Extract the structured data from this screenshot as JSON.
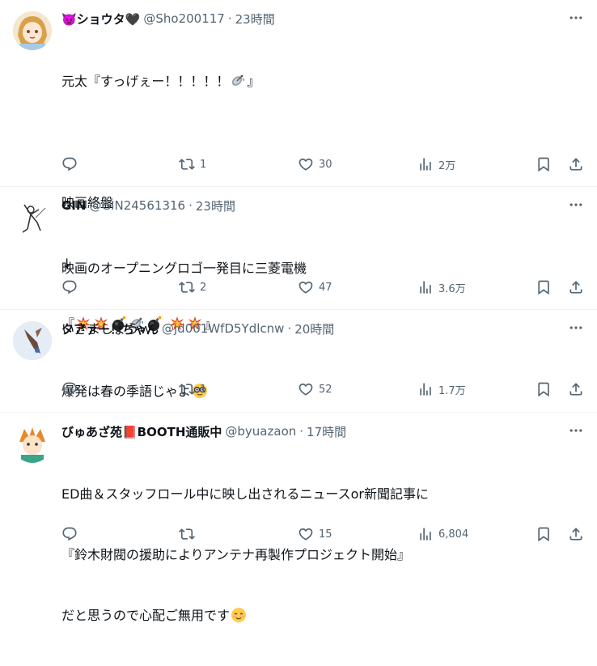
{
  "tweets": [
    {
      "name": "👿ショウタ🖤",
      "handle": "@Sho200117",
      "time": "23時間",
      "text_line1": "元太『すっげぇー！！！！！",
      "text_line1_end": "』",
      "text_line2": "映画終盤",
      "text_line3": "↓",
      "text_line4": "『",
      "text_line4_end": "』",
      "reply_count": "",
      "retweet_count": "1",
      "like_count": "30",
      "view_count": "2万"
    },
    {
      "name": "GIN",
      "handle": "@GIN24561316",
      "time": "23時間",
      "text_line1": "映画のオープニングロゴ一発目に三菱電機",
      "text_line2": "いきましょうｗ",
      "reply_count": "",
      "retweet_count": "2",
      "like_count": "47",
      "view_count": "3.6万"
    },
    {
      "name": "タアァー！ちゃん",
      "handle": "@jd001WfD5Ydlcnw",
      "time": "20時間",
      "text_line1": "爆発は春の季語じゃよ",
      "reply_count": "",
      "retweet_count": "1",
      "like_count": "52",
      "view_count": "1.7万"
    },
    {
      "name": "びゅあざ苑📕BOOTH通販中",
      "handle": "@byuazaon",
      "time": "17時間",
      "text_line1": "ED曲＆スタッフロール中に映し出されるニュースor新聞記事に",
      "text_line2": "『鈴木財閥の援助によりアンテナ再製作プロジェクト開始』",
      "text_line3": "だと思うので心配ご無用です",
      "reply_count": "",
      "retweet_count": "",
      "like_count": "15",
      "view_count": "6,804"
    }
  ],
  "icons": {
    "reply": "reply-icon",
    "retweet": "retweet-icon",
    "like": "heart-icon",
    "views": "views-icon",
    "bookmark": "bookmark-icon",
    "share": "share-icon",
    "more": "more-icon"
  },
  "colors": {
    "text": "#0f1419",
    "secondary": "#536471",
    "divider": "#eff3f4"
  }
}
